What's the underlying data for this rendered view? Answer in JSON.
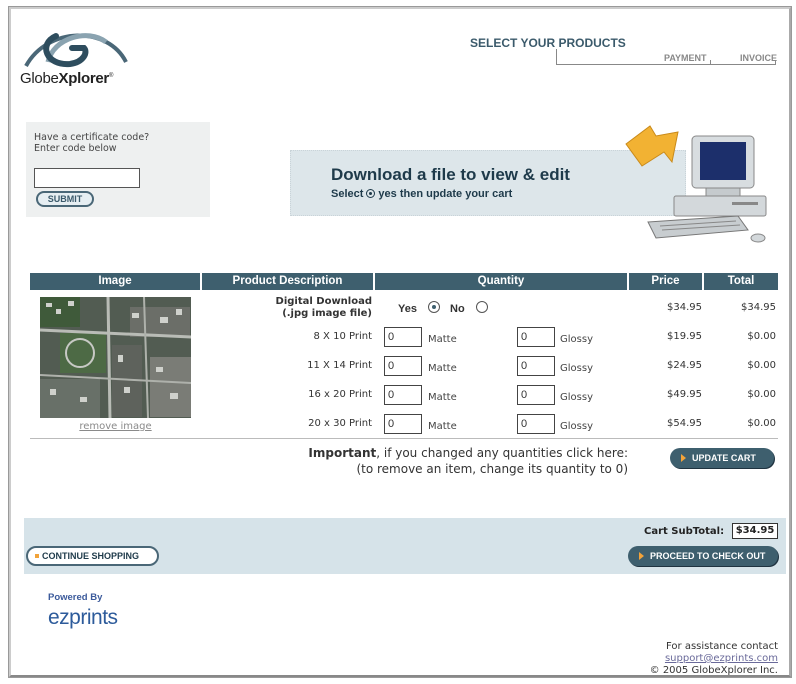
{
  "brand": {
    "logo_text_plain": "Globe",
    "logo_text_bold": "Xplorer",
    "logo_tm": "®"
  },
  "steps": {
    "active": "SELECT YOUR PRODUCTS",
    "payment": "PAYMENT",
    "invoice": "INVOICE"
  },
  "certificate": {
    "label": "Have a certificate code?\nEnter code below",
    "input_value": "",
    "submit_label": "SUBMIT"
  },
  "banner": {
    "title": "Download a file to view & edit",
    "sub_before": "Select",
    "sub_after": "yes then update your cart"
  },
  "table": {
    "headers": [
      "Image",
      "Product Description",
      "Quantity",
      "Price",
      "Total"
    ],
    "remove_image": "remove image",
    "download": {
      "title": "Digital Download",
      "subtitle": "(.jpg image file)",
      "yes_label": "Yes",
      "no_label": "No",
      "selected": "yes",
      "price": "$34.95",
      "total": "$34.95"
    },
    "rows": [
      {
        "label": "8 X 10 Print",
        "matte": "0",
        "glossy": "0",
        "price": "$19.95",
        "total": "$0.00"
      },
      {
        "label": "11 X 14 Print",
        "matte": "0",
        "glossy": "0",
        "price": "$24.95",
        "total": "$0.00"
      },
      {
        "label": "16 x 20 Print",
        "matte": "0",
        "glossy": "0",
        "price": "$49.95",
        "total": "$0.00"
      },
      {
        "label": "20 x 30 Print",
        "matte": "0",
        "glossy": "0",
        "price": "$54.95",
        "total": "$0.00"
      }
    ],
    "matte_label": "Matte",
    "glossy_label": "Glossy"
  },
  "important": {
    "bold": "Important",
    "line1_rest": ", if you changed any quantities click here:",
    "line2": "(to remove an item, change its quantity to 0)"
  },
  "buttons": {
    "update_cart": "UPDATE CART",
    "continue_shopping": "CONTINUE SHOPPING",
    "checkout": "PROCEED TO CHECK OUT"
  },
  "cart": {
    "subtotal_label": "Cart SubTotal:",
    "subtotal_value": "$34.95"
  },
  "footer": {
    "powered_by": "Powered By",
    "ezprints": "ezprints",
    "assist_label": "For assistance contact",
    "email": "support@ezprints.com",
    "copyright": "© 2005 GlobeXplorer Inc."
  },
  "colors": {
    "header_teal": "#3e5f6e",
    "subtotal_bar": "#d6e3e9",
    "accent_orange": "#f2a33a"
  }
}
